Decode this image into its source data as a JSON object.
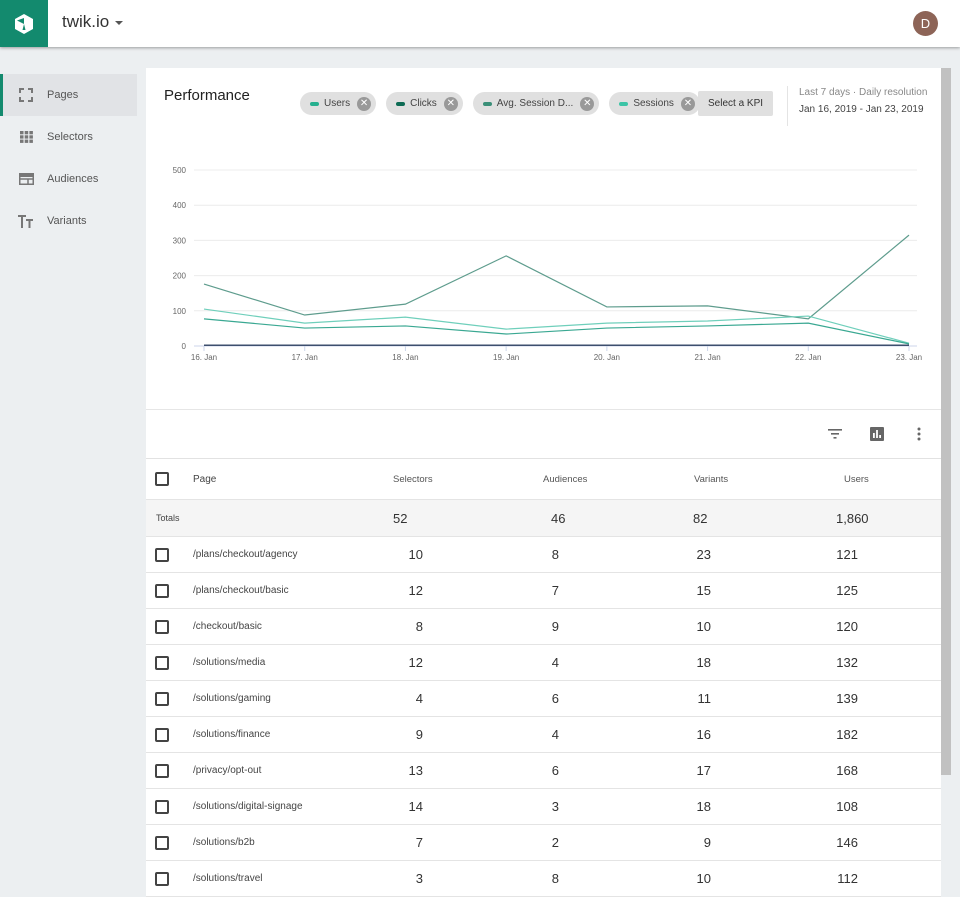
{
  "app": {
    "title": "twik.io",
    "logo_icon": "cube-logo-icon",
    "brand_color": "#138a6e",
    "avatar_initial": "D",
    "avatar_color": "#8d6457"
  },
  "sidebar": {
    "items": [
      {
        "label": "Pages",
        "icon": "pages-icon",
        "active": true
      },
      {
        "label": "Selectors",
        "icon": "grid-icon",
        "active": false
      },
      {
        "label": "Audiences",
        "icon": "window-icon",
        "active": false
      },
      {
        "label": "Variants",
        "icon": "text-size-icon",
        "active": false
      }
    ]
  },
  "performance": {
    "title": "Performance",
    "chips": [
      {
        "label": "Users",
        "color": "#26b08f"
      },
      {
        "label": "Clicks",
        "color": "#0d6b54"
      },
      {
        "label": "Avg. Session D...",
        "color": "#3a8f78"
      },
      {
        "label": "Sessions",
        "color": "#3cc4a6"
      }
    ],
    "kpi_button": "Select a KPI",
    "range_label": "Last 7 days · Daily resolution",
    "range_dates": "Jan 16, 2019 - Jan 23, 2019"
  },
  "chart_data": {
    "type": "line",
    "title": "",
    "xlabel": "",
    "ylabel": "",
    "x": [
      "16. Jan",
      "17. Jan",
      "18. Jan",
      "19. Jan",
      "20. Jan",
      "21. Jan",
      "22. Jan",
      "23. Jan"
    ],
    "yticks": [
      0,
      100,
      200,
      300,
      400,
      500
    ],
    "ylim": [
      0,
      500
    ],
    "grid": true,
    "legend": "none",
    "series": [
      {
        "name": "Sessions",
        "color": "#5e9c8d",
        "values": [
          176,
          88,
          119,
          256,
          111,
          114,
          77,
          315
        ]
      },
      {
        "name": "Users",
        "color": "#6fcfbb",
        "values": [
          105,
          65,
          82,
          48,
          65,
          71,
          85,
          8
        ]
      },
      {
        "name": "Avg. Session Duration",
        "color": "#3aa892",
        "values": [
          77,
          51,
          57,
          34,
          51,
          57,
          65,
          6
        ]
      },
      {
        "name": "Clicks",
        "color": "#3d4f6e",
        "values": [
          2,
          2,
          2,
          2,
          2,
          2,
          2,
          2
        ]
      }
    ]
  },
  "table": {
    "tools": [
      "filter-icon",
      "chart-icon",
      "more-vert-icon"
    ],
    "columns": [
      "Page",
      "Selectors",
      "Audiences",
      "Variants",
      "Users"
    ],
    "totals": {
      "label": "Totals",
      "selectors": "52",
      "audiences": "46",
      "variants": "82",
      "users": "1,860"
    },
    "rows": [
      {
        "page": "/plans/checkout/agency",
        "selectors": "10",
        "audiences": "8",
        "variants": "23",
        "users": "121"
      },
      {
        "page": "/plans/checkout/basic",
        "selectors": "12",
        "audiences": "7",
        "variants": "15",
        "users": "125"
      },
      {
        "page": "/checkout/basic",
        "selectors": "8",
        "audiences": "9",
        "variants": "10",
        "users": "120"
      },
      {
        "page": "/solutions/media",
        "selectors": "12",
        "audiences": "4",
        "variants": "18",
        "users": "132"
      },
      {
        "page": "/solutions/gaming",
        "selectors": "4",
        "audiences": "6",
        "variants": "11",
        "users": "139"
      },
      {
        "page": "/solutions/finance",
        "selectors": "9",
        "audiences": "4",
        "variants": "16",
        "users": "182"
      },
      {
        "page": "/privacy/opt-out",
        "selectors": "13",
        "audiences": "6",
        "variants": "17",
        "users": "168"
      },
      {
        "page": "/solutions/digital-signage",
        "selectors": "14",
        "audiences": "3",
        "variants": "18",
        "users": "108"
      },
      {
        "page": "/solutions/b2b",
        "selectors": "7",
        "audiences": "2",
        "variants": "9",
        "users": "146"
      },
      {
        "page": "/solutions/travel",
        "selectors": "3",
        "audiences": "8",
        "variants": "10",
        "users": "112"
      }
    ]
  }
}
